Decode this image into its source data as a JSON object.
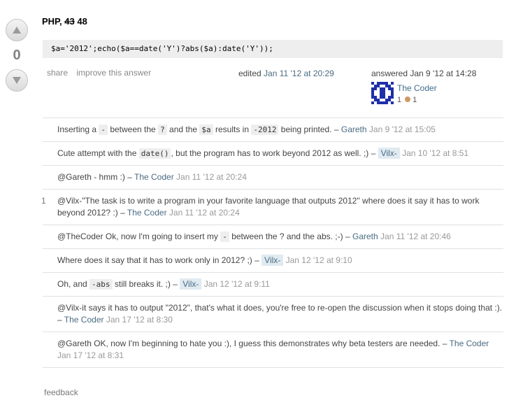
{
  "vote": {
    "score": "0"
  },
  "answer": {
    "title_lang": "PHP, ",
    "title_old": "43",
    "title_new": " 48",
    "code": "$a='2012';echo($a==date('Y')?abs($a):date('Y'));",
    "menu": {
      "share": "share",
      "improve": "improve this answer"
    },
    "edited_label": "edited ",
    "edited_date": "Jan 11 '12 at 20:29",
    "answered_label": "answered Jan 9 '12 at 14:28",
    "owner": {
      "name": "The Coder",
      "rep": "1",
      "bronze": "1"
    }
  },
  "comments": [
    {
      "score": "",
      "parts": [
        {
          "t": "text",
          "v": "Inserting a "
        },
        {
          "t": "code",
          "v": "-"
        },
        {
          "t": "text",
          "v": " between the "
        },
        {
          "t": "code",
          "v": "?"
        },
        {
          "t": "text",
          "v": " and the "
        },
        {
          "t": "code",
          "v": "$a"
        },
        {
          "t": "text",
          "v": " results in "
        },
        {
          "t": "code",
          "v": "-2012"
        },
        {
          "t": "text",
          "v": " being printed. – "
        },
        {
          "t": "user",
          "v": "Gareth"
        },
        {
          "t": "text",
          "v": " "
        },
        {
          "t": "date",
          "v": "Jan 9 '12 at 15:05"
        }
      ]
    },
    {
      "score": "",
      "parts": [
        {
          "t": "text",
          "v": "Cute attempt with the "
        },
        {
          "t": "code",
          "v": "date()"
        },
        {
          "t": "text",
          "v": ", but the program has to work beyond 2012 as well. ;) – "
        },
        {
          "t": "userhl",
          "v": "Vilx-"
        },
        {
          "t": "text",
          "v": " "
        },
        {
          "t": "date",
          "v": "Jan 10 '12 at 8:51"
        }
      ]
    },
    {
      "score": "",
      "parts": [
        {
          "t": "text",
          "v": "@Gareth - hmm :) – "
        },
        {
          "t": "user",
          "v": "The Coder"
        },
        {
          "t": "text",
          "v": " "
        },
        {
          "t": "date",
          "v": "Jan 11 '12 at 20:24"
        }
      ]
    },
    {
      "score": "1",
      "parts": [
        {
          "t": "text",
          "v": "@Vilx-\"The task is to write a program in your favorite language that outputs 2012\" where does it say it has to work beyond 2012? :) – "
        },
        {
          "t": "user",
          "v": "The Coder"
        },
        {
          "t": "text",
          "v": " "
        },
        {
          "t": "date",
          "v": "Jan 11 '12 at 20:24"
        }
      ]
    },
    {
      "score": "",
      "parts": [
        {
          "t": "text",
          "v": "@TheCoder Ok, now I'm going to insert my "
        },
        {
          "t": "code",
          "v": "-"
        },
        {
          "t": "text",
          "v": " between the ? and the abs. ;-) – "
        },
        {
          "t": "user",
          "v": "Gareth"
        },
        {
          "t": "text",
          "v": " "
        },
        {
          "t": "date",
          "v": "Jan 11 '12 at 20:46"
        }
      ]
    },
    {
      "score": "",
      "parts": [
        {
          "t": "text",
          "v": "Where does it say that it has to work only in 2012? ;) – "
        },
        {
          "t": "userhl",
          "v": "Vilx-"
        },
        {
          "t": "text",
          "v": " "
        },
        {
          "t": "date",
          "v": "Jan 12 '12 at 9:10"
        }
      ]
    },
    {
      "score": "",
      "parts": [
        {
          "t": "text",
          "v": "Oh, and "
        },
        {
          "t": "code",
          "v": "-abs"
        },
        {
          "t": "text",
          "v": " still breaks it. ;) – "
        },
        {
          "t": "userhl",
          "v": "Vilx-"
        },
        {
          "t": "text",
          "v": " "
        },
        {
          "t": "date",
          "v": "Jan 12 '12 at 9:11"
        }
      ]
    },
    {
      "score": "",
      "parts": [
        {
          "t": "text",
          "v": "@Vilx-it says it has to output \"2012\", that's what it does, you're free to re-open the discussion when it stops doing that :). – "
        },
        {
          "t": "user",
          "v": "The Coder"
        },
        {
          "t": "text",
          "v": " "
        },
        {
          "t": "date",
          "v": "Jan 17 '12 at 8:30"
        }
      ]
    },
    {
      "score": "",
      "parts": [
        {
          "t": "text",
          "v": "@Gareth OK, now I'm beginning to hate you :), I guess this demonstrates why beta testers are needed. – "
        },
        {
          "t": "user",
          "v": "The Coder"
        },
        {
          "t": "text",
          "v": " "
        },
        {
          "t": "date",
          "v": "Jan 17 '12 at 8:31"
        }
      ]
    }
  ],
  "footer": {
    "feedback": "feedback"
  }
}
